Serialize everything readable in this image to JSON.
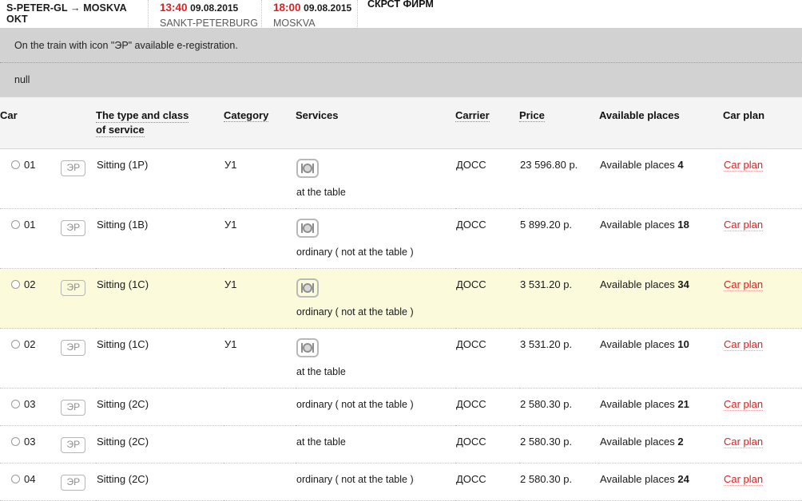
{
  "train_header": {
    "route": "S-PETER-GL → MOSKVA OKT",
    "departure": {
      "time": "13:40",
      "date": "09.08.2015",
      "station": "SANKT-PETERBURG"
    },
    "arrival": {
      "time": "18:00",
      "date": "09.08.2015",
      "station": "MOSKVA"
    },
    "firm_label": "СКРСТ ФИРМ"
  },
  "notices": [
    "On the train with icon \"ЭР\" available e-registration.",
    "null"
  ],
  "table": {
    "headers": {
      "car": "Car",
      "type_line1": "The type and class",
      "type_line2": "of service",
      "category": "Category",
      "services": "Services",
      "carrier": "Carrier",
      "price": "Price",
      "available": "Available places",
      "car_plan": "Car plan"
    },
    "avail_prefix": "Available places",
    "er_badge": "ЭР",
    "plan_link": "Car plan",
    "rows": [
      {
        "car": "01",
        "er": "ЭР",
        "type": "Sitting (1P)",
        "category": "У1",
        "has_meal_icon": true,
        "service_text": "at the table",
        "carrier": "ДОСС",
        "price": "23 596.80 р.",
        "avail_count": "4",
        "plan": "Car plan",
        "highlighted": false
      },
      {
        "car": "01",
        "er": "ЭР",
        "type": "Sitting (1B)",
        "category": "У1",
        "has_meal_icon": true,
        "service_text": "ordinary ( not at the table )",
        "carrier": "ДОСС",
        "price": "5 899.20 р.",
        "avail_count": "18",
        "plan": "Car plan",
        "highlighted": false
      },
      {
        "car": "02",
        "er": "ЭР",
        "type": "Sitting (1C)",
        "category": "У1",
        "has_meal_icon": true,
        "service_text": "ordinary ( not at the table )",
        "carrier": "ДОСС",
        "price": "3 531.20 р.",
        "avail_count": "34",
        "plan": "Car plan",
        "highlighted": true
      },
      {
        "car": "02",
        "er": "ЭР",
        "type": "Sitting (1C)",
        "category": "У1",
        "has_meal_icon": true,
        "service_text": "at the table",
        "carrier": "ДОСС",
        "price": "3 531.20 р.",
        "avail_count": "10",
        "plan": "Car plan",
        "highlighted": false
      },
      {
        "car": "03",
        "er": "ЭР",
        "type": "Sitting (2C)",
        "category": "",
        "has_meal_icon": false,
        "service_text": "ordinary ( not at the table )",
        "carrier": "ДОСС",
        "price": "2 580.30 р.",
        "avail_count": "21",
        "plan": "Car plan",
        "highlighted": false
      },
      {
        "car": "03",
        "er": "ЭР",
        "type": "Sitting (2C)",
        "category": "",
        "has_meal_icon": false,
        "service_text": "at the table",
        "carrier": "ДОСС",
        "price": "2 580.30 р.",
        "avail_count": "2",
        "plan": "Car plan",
        "highlighted": false
      },
      {
        "car": "04",
        "er": "ЭР",
        "type": "Sitting (2C)",
        "category": "",
        "has_meal_icon": false,
        "service_text": "ordinary ( not at the table )",
        "carrier": "ДОСС",
        "price": "2 580.30 р.",
        "avail_count": "24",
        "plan": "Car plan",
        "highlighted": false
      }
    ]
  },
  "colors": {
    "accent_red": "#e02020",
    "notice_bg": "#d2d2d2",
    "highlight_row": "#fbfbdc",
    "header_bg": "#f4f4f4"
  }
}
